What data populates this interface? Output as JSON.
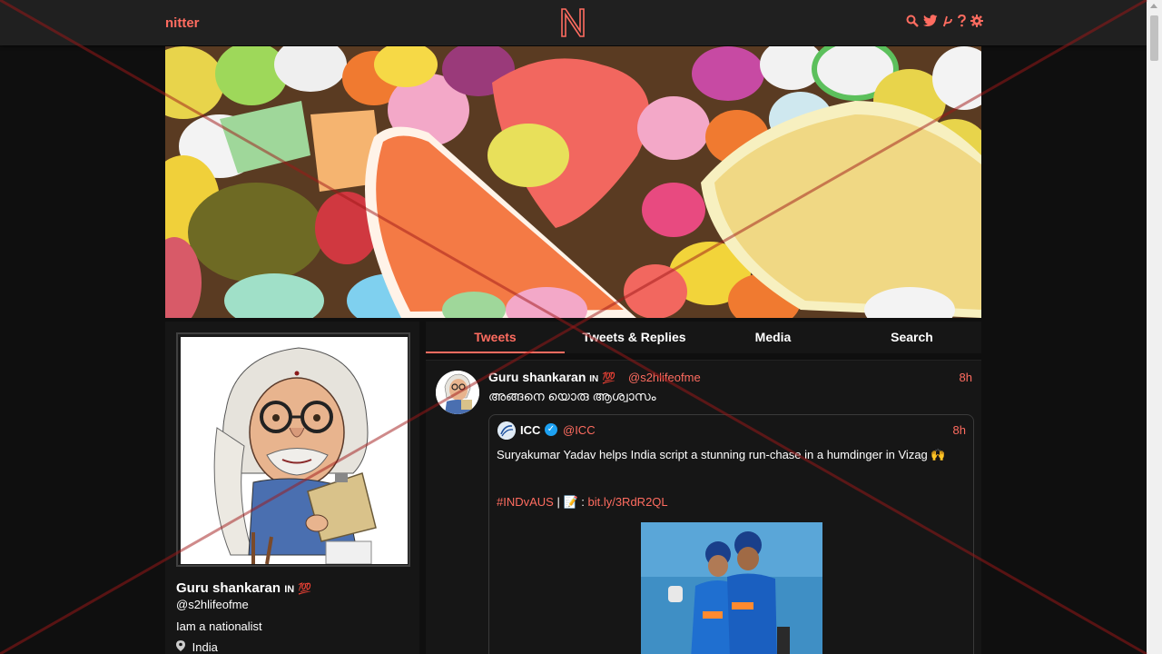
{
  "navbar": {
    "brand": "nitter",
    "logo_letter": "N",
    "icons": [
      "search-icon",
      "twitter-icon",
      "rss-icon",
      "help-icon",
      "settings-icon"
    ]
  },
  "profile": {
    "fullname": "Guru shankaran",
    "flag": "IN",
    "badge": "💯",
    "handle": "@s2hlifeofme",
    "bio": "Iam a nationalist",
    "location": "India"
  },
  "tabs": [
    {
      "label": "Tweets",
      "active": true
    },
    {
      "label": "Tweets & Replies",
      "active": false
    },
    {
      "label": "Media",
      "active": false
    },
    {
      "label": "Search",
      "active": false
    }
  ],
  "tweet": {
    "fullname": "Guru shankaran",
    "flag": "IN",
    "badge": "💯",
    "handle": "@s2hlifeofme",
    "date": "8h",
    "content": "അങ്ങനെ യൊരു ആശ്വാസം",
    "quote": {
      "name": "ICC",
      "verified": "✓",
      "handle": "@ICC",
      "date": "8h",
      "text": "Suryakumar Yadav helps India script a stunning run-chase in a humdinger in Vizag 🙌",
      "hashtag": "#INDvAUS",
      "separator": " | 📝 : ",
      "link": "bit.ly/3RdR2QL"
    }
  },
  "colors": {
    "accent": "#ff6c60",
    "background": "#0f0f0f",
    "panel": "#161616",
    "navbar": "#202020"
  }
}
